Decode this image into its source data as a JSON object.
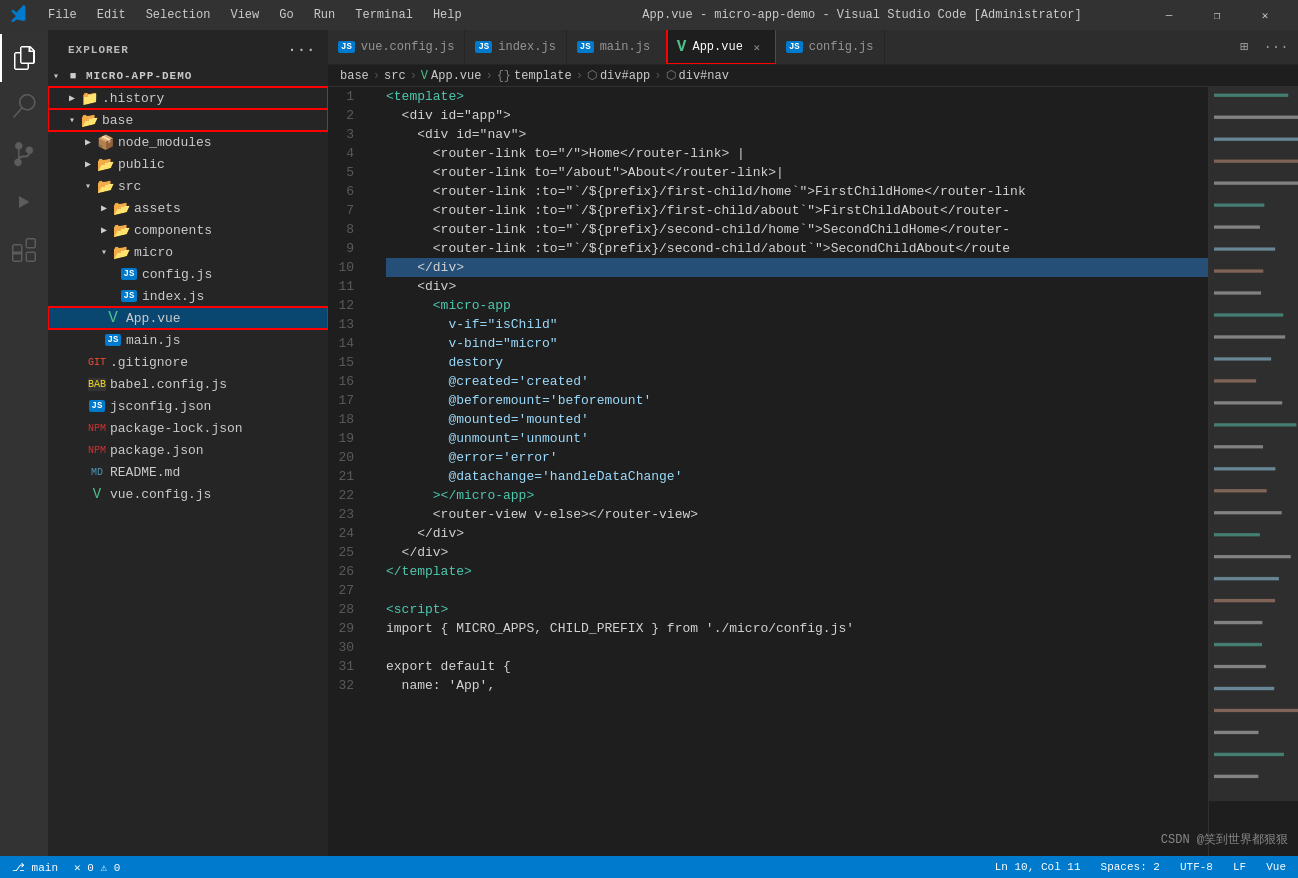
{
  "titleBar": {
    "title": "App.vue - micro-app-demo - Visual Studio Code [Administrator]",
    "menus": [
      "File",
      "Edit",
      "Selection",
      "View",
      "Go",
      "Run",
      "Terminal",
      "Help"
    ]
  },
  "tabs": [
    {
      "id": "vue-config",
      "icon": "js-icon",
      "label": "vue.config.js",
      "active": false
    },
    {
      "id": "index-js",
      "icon": "js-icon",
      "label": "index.js",
      "active": false
    },
    {
      "id": "main-js",
      "icon": "js-icon",
      "label": "main.js",
      "active": false
    },
    {
      "id": "app-vue",
      "icon": "vue-icon",
      "label": "App.vue",
      "active": true
    },
    {
      "id": "config-js",
      "icon": "js-icon",
      "label": "config.js",
      "active": false
    }
  ],
  "breadcrumb": {
    "items": [
      "base",
      "src",
      "App.vue",
      "{} template",
      "div#app",
      "div#nav"
    ]
  },
  "sidebar": {
    "title": "EXPLORER",
    "project": "MICRO-APP-DEMO",
    "tree": [
      {
        "depth": 0,
        "type": "folder",
        "open": false,
        "label": ".history",
        "highlight": false
      },
      {
        "depth": 0,
        "type": "folder",
        "open": true,
        "label": "base",
        "highlight": true
      },
      {
        "depth": 1,
        "type": "folder-npm",
        "open": false,
        "label": "node_modules"
      },
      {
        "depth": 1,
        "type": "folder-pub",
        "open": false,
        "label": "public"
      },
      {
        "depth": 1,
        "type": "folder-src",
        "open": true,
        "label": "src"
      },
      {
        "depth": 2,
        "type": "folder-assets",
        "open": false,
        "label": "assets"
      },
      {
        "depth": 2,
        "type": "folder-comp",
        "open": false,
        "label": "components"
      },
      {
        "depth": 2,
        "type": "folder-micro",
        "open": true,
        "label": "micro"
      },
      {
        "depth": 3,
        "type": "js",
        "label": "config.js"
      },
      {
        "depth": 3,
        "type": "js",
        "label": "index.js"
      },
      {
        "depth": 2,
        "type": "vue",
        "label": "App.vue",
        "selected": true,
        "highlight": true
      },
      {
        "depth": 2,
        "type": "js",
        "label": "main.js"
      },
      {
        "depth": 1,
        "type": "gitignore",
        "label": ".gitignore"
      },
      {
        "depth": 1,
        "type": "babel",
        "label": "babel.config.js"
      },
      {
        "depth": 1,
        "type": "json",
        "label": "jsconfig.json"
      },
      {
        "depth": 1,
        "type": "npm-lock",
        "label": "package-lock.json"
      },
      {
        "depth": 1,
        "type": "npm",
        "label": "package.json"
      },
      {
        "depth": 1,
        "type": "md",
        "label": "README.md"
      },
      {
        "depth": 1,
        "type": "vue-config",
        "label": "vue.config.js"
      }
    ]
  },
  "codeLines": [
    {
      "num": 1,
      "tokens": [
        {
          "t": "<template>",
          "c": "c-tag"
        }
      ]
    },
    {
      "num": 2,
      "tokens": [
        {
          "t": "  <div id=\"app\">",
          "c": "c-text"
        }
      ]
    },
    {
      "num": 3,
      "tokens": [
        {
          "t": "    <div id=\"nav\">",
          "c": "c-text"
        }
      ]
    },
    {
      "num": 4,
      "tokens": [
        {
          "t": "      <router-link to=\"/\">Home</router-link> |",
          "c": "c-text"
        }
      ]
    },
    {
      "num": 5,
      "tokens": [
        {
          "t": "      <router-link to=\"/about\">About</router-link>|",
          "c": "c-text"
        }
      ]
    },
    {
      "num": 6,
      "tokens": [
        {
          "t": "      <router-link :to=\"`/${prefix}/first-child/home`\">FirstChildHome</router-link",
          "c": "c-text"
        }
      ]
    },
    {
      "num": 7,
      "tokens": [
        {
          "t": "      <router-link :to=\"`/${prefix}/first-child/about`\">FirstChildAbout</router-",
          "c": "c-text"
        }
      ]
    },
    {
      "num": 8,
      "tokens": [
        {
          "t": "      <router-link :to=\"`/${prefix}/second-child/home`\">SecondChildHome</router-",
          "c": "c-text"
        }
      ]
    },
    {
      "num": 9,
      "tokens": [
        {
          "t": "      <router-link :to=\"`/${prefix}/second-child/about`\">SecondChildAbout</route",
          "c": "c-text"
        }
      ]
    },
    {
      "num": 10,
      "tokens": [
        {
          "t": "    </div>",
          "c": "c-text"
        }
      ],
      "selected": true
    },
    {
      "num": 11,
      "tokens": [
        {
          "t": "    <div>",
          "c": "c-text"
        }
      ]
    },
    {
      "num": 12,
      "tokens": [
        {
          "t": "      <micro-app",
          "c": "c-tag"
        }
      ]
    },
    {
      "num": 13,
      "tokens": [
        {
          "t": "        v-if=\"isChild\"",
          "c": "c-attr"
        }
      ]
    },
    {
      "num": 14,
      "tokens": [
        {
          "t": "        v-bind=\"micro\"",
          "c": "c-attr"
        }
      ]
    },
    {
      "num": 15,
      "tokens": [
        {
          "t": "        destory",
          "c": "c-attr"
        }
      ]
    },
    {
      "num": 16,
      "tokens": [
        {
          "t": "        @created='created'",
          "c": "c-attr"
        }
      ]
    },
    {
      "num": 17,
      "tokens": [
        {
          "t": "        @beforemount='beforemount'",
          "c": "c-attr"
        }
      ]
    },
    {
      "num": 18,
      "tokens": [
        {
          "t": "        @mounted='mounted'",
          "c": "c-attr"
        }
      ]
    },
    {
      "num": 19,
      "tokens": [
        {
          "t": "        @unmount='unmount'",
          "c": "c-attr"
        }
      ]
    },
    {
      "num": 20,
      "tokens": [
        {
          "t": "        @error='error'",
          "c": "c-attr"
        }
      ]
    },
    {
      "num": 21,
      "tokens": [
        {
          "t": "        @datachange='handleDataChange'",
          "c": "c-attr"
        }
      ]
    },
    {
      "num": 22,
      "tokens": [
        {
          "t": "      ></micro-app>",
          "c": "c-tag"
        }
      ]
    },
    {
      "num": 23,
      "tokens": [
        {
          "t": "      <router-view v-else></router-view>",
          "c": "c-text"
        }
      ]
    },
    {
      "num": 24,
      "tokens": [
        {
          "t": "    </div>",
          "c": "c-text"
        }
      ]
    },
    {
      "num": 25,
      "tokens": [
        {
          "t": "  </div>",
          "c": "c-text"
        }
      ]
    },
    {
      "num": 26,
      "tokens": [
        {
          "t": "</template>",
          "c": "c-tag"
        }
      ]
    },
    {
      "num": 27,
      "tokens": [
        {
          "t": "",
          "c": "c-text"
        }
      ]
    },
    {
      "num": 28,
      "tokens": [
        {
          "t": "<script>",
          "c": "c-tag"
        }
      ]
    },
    {
      "num": 29,
      "tokens": [
        {
          "t": "import { MICRO_APPS, CHILD_PREFIX } from './micro/config.js'",
          "c": "c-text"
        }
      ]
    },
    {
      "num": 30,
      "tokens": [
        {
          "t": "",
          "c": "c-text"
        }
      ]
    },
    {
      "num": 31,
      "tokens": [
        {
          "t": "export default {",
          "c": "c-text"
        }
      ]
    },
    {
      "num": 32,
      "tokens": [
        {
          "t": "  name: 'App',",
          "c": "c-text"
        }
      ]
    }
  ],
  "statusBar": {
    "branch": "main",
    "errors": "0",
    "warnings": "0",
    "line": "Ln 10, Col 11",
    "spaces": "Spaces: 2",
    "encoding": "UTF-8",
    "lineEnding": "LF",
    "language": "Vue"
  },
  "watermark": "CSDN @笑到世界都狠狠"
}
